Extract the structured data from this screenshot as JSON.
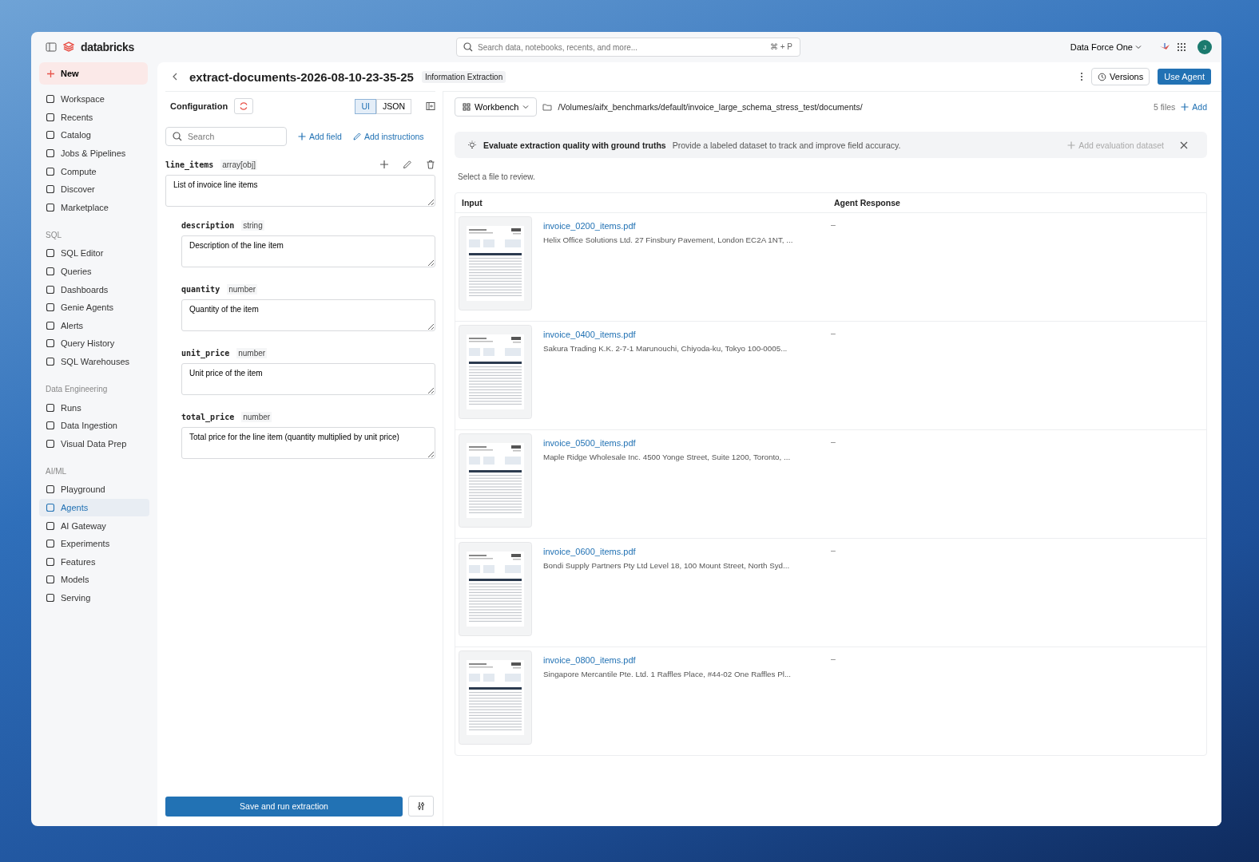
{
  "topbar": {
    "brand": "databricks",
    "search": {
      "placeholder": "Search data, notebooks, recents, and more...",
      "shortcut": "⌘ + P"
    },
    "workspace": "Data Force One",
    "avatar": "J"
  },
  "sidebar": {
    "new_label": "New",
    "sections": [
      {
        "items": [
          {
            "label": "Workspace",
            "selected": false
          },
          {
            "label": "Recents",
            "selected": false
          },
          {
            "label": "Catalog",
            "selected": false
          },
          {
            "label": "Jobs & Pipelines",
            "selected": false
          },
          {
            "label": "Compute",
            "selected": false
          },
          {
            "label": "Discover",
            "selected": false
          },
          {
            "label": "Marketplace",
            "selected": false
          }
        ]
      },
      {
        "heading": "SQL",
        "items": [
          {
            "label": "SQL Editor",
            "selected": false
          },
          {
            "label": "Queries",
            "selected": false
          },
          {
            "label": "Dashboards",
            "selected": false
          },
          {
            "label": "Genie Agents",
            "selected": false
          },
          {
            "label": "Alerts",
            "selected": false
          },
          {
            "label": "Query History",
            "selected": false
          },
          {
            "label": "SQL Warehouses",
            "selected": false
          }
        ]
      },
      {
        "heading": "Data Engineering",
        "items": [
          {
            "label": "Runs",
            "selected": false
          },
          {
            "label": "Data Ingestion",
            "selected": false
          },
          {
            "label": "Visual Data Prep",
            "selected": false
          }
        ]
      },
      {
        "heading": "AI/ML",
        "items": [
          {
            "label": "Playground",
            "selected": false
          },
          {
            "label": "Agents",
            "selected": true
          },
          {
            "label": "AI Gateway",
            "selected": false
          },
          {
            "label": "Experiments",
            "selected": false
          },
          {
            "label": "Features",
            "selected": false
          },
          {
            "label": "Models",
            "selected": false
          },
          {
            "label": "Serving",
            "selected": false
          }
        ]
      }
    ]
  },
  "header": {
    "title": "extract-documents-2026-08-10-23-35-25",
    "tag": "Information Extraction",
    "versions": "Versions",
    "use_agent": "Use Agent"
  },
  "config": {
    "title": "Configuration",
    "modes": [
      {
        "label": "UI",
        "selected": true
      },
      {
        "label": "JSON",
        "selected": false
      }
    ],
    "search": {
      "placeholder": "Search"
    },
    "add_field": "Add field",
    "add_instructions": "Add instructions",
    "field": {
      "name": "line_items",
      "type": "array[obj]",
      "description": "List of invoice line items",
      "children": [
        {
          "name": "description",
          "type": "string",
          "description": "Description of the line item"
        },
        {
          "name": "quantity",
          "type": "number",
          "description": "Quantity of the item"
        },
        {
          "name": "unit_price",
          "type": "number",
          "description": "Unit price of the item"
        },
        {
          "name": "total_price",
          "type": "number",
          "description": "Total price for the line item (quantity multiplied by unit price)"
        }
      ]
    },
    "run_button": "Save and run extraction"
  },
  "workbench": {
    "view": "Workbench",
    "path": "/Volumes/aifx_benchmarks/default/invoice_large_schema_stress_test/documents/",
    "count": "5 files",
    "add": "Add",
    "banner": {
      "title": "Evaluate extraction quality with ground truths",
      "text": "Provide a labeled dataset to track and improve field accuracy.",
      "action": "Add evaluation dataset"
    },
    "hint": "Select a file to review.",
    "columns": [
      "Input",
      "Agent Response"
    ],
    "rows": [
      {
        "file": "invoice_0200_items.pdf",
        "preview": "Helix Office Solutions Ltd. 27 Finsbury Pavement, London EC2A 1NT, ...",
        "response": "–"
      },
      {
        "file": "invoice_0400_items.pdf",
        "preview": "Sakura Trading K.K. 2-7-1 Marunouchi, Chiyoda-ku, Tokyo 100-0005...",
        "response": "–"
      },
      {
        "file": "invoice_0500_items.pdf",
        "preview": "Maple Ridge Wholesale Inc. 4500 Yonge Street, Suite 1200, Toronto, ...",
        "response": "–"
      },
      {
        "file": "invoice_0600_items.pdf",
        "preview": "Bondi Supply Partners Pty Ltd Level 18, 100 Mount Street, North Syd...",
        "response": "–"
      },
      {
        "file": "invoice_0800_items.pdf",
        "preview": "Singapore Mercantile Pte. Ltd. 1 Raffles Place, #44-02 One Raffles Pl...",
        "response": "–"
      }
    ]
  }
}
